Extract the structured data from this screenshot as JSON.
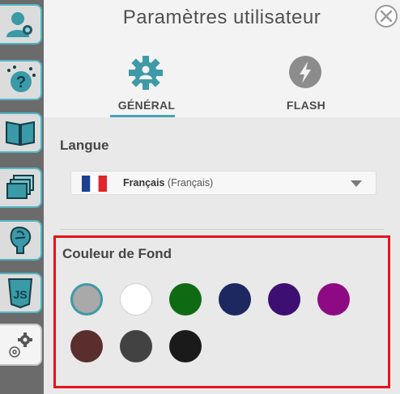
{
  "header": {
    "title": "Paramètres utilisateur",
    "close_icon": "close-icon"
  },
  "rail": {
    "items": [
      {
        "icon": "user-profile-icon",
        "active": false
      },
      {
        "icon": "help-question-icon",
        "active": false
      },
      {
        "icon": "open-book-icon",
        "active": false
      },
      {
        "icon": "windows-stack-icon",
        "active": false
      },
      {
        "icon": "brain-head-icon",
        "active": false
      },
      {
        "icon": "javascript-icon",
        "active": false
      },
      {
        "icon": "settings-gears-icon",
        "active": true
      }
    ]
  },
  "tabs": [
    {
      "label": "GÉNÉRAL",
      "icon": "gear-user-icon",
      "active": true,
      "accent": "#3f9aa8"
    },
    {
      "label": "FLASH",
      "icon": "flash-icon",
      "active": false,
      "accent": "#8c8c8c"
    }
  ],
  "language": {
    "title": "Langue",
    "selected_name": "Français",
    "selected_native": "(Français)",
    "flag_icon": "france-flag-icon"
  },
  "background_color": {
    "title": "Couleur de Fond",
    "swatches": [
      {
        "color": "#a9a9a9",
        "selected": true
      },
      {
        "color": "#ffffff",
        "selected": false
      },
      {
        "color": "#0f6b13",
        "selected": false
      },
      {
        "color": "#1d2860",
        "selected": false
      },
      {
        "color": "#3e0f72",
        "selected": false
      },
      {
        "color": "#8e0a84",
        "selected": false
      },
      {
        "color": "#5a2e2c",
        "selected": false
      },
      {
        "color": "#424242",
        "selected": false
      },
      {
        "color": "#1a1a1a",
        "selected": false
      }
    ]
  }
}
